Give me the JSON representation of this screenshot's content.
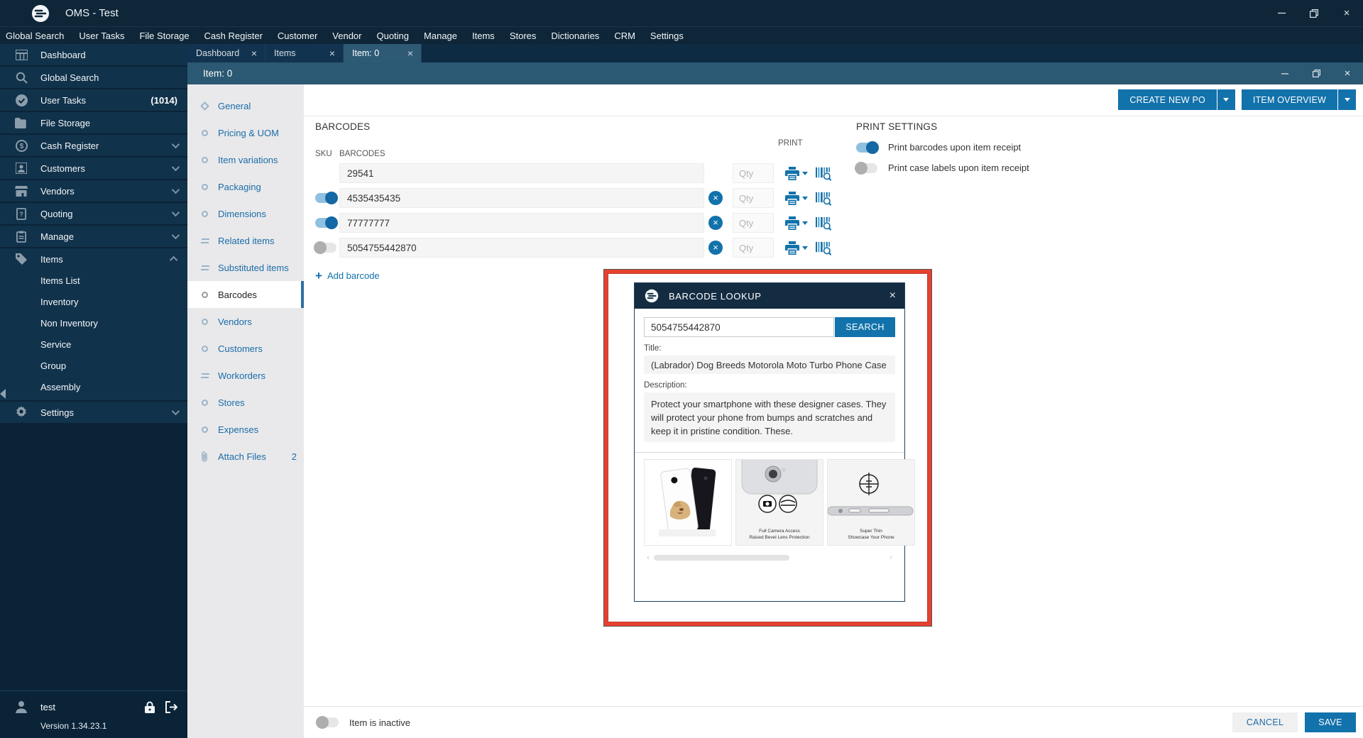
{
  "app": {
    "title": "OMS - Test"
  },
  "menu_bar": {
    "items": [
      "Global Search",
      "User Tasks",
      "File Storage",
      "Cash Register",
      "Customer",
      "Vendor",
      "Quoting",
      "Manage",
      "Items",
      "Stores",
      "Dictionaries",
      "CRM",
      "Settings"
    ]
  },
  "sidebar": {
    "items": [
      {
        "label": "Dashboard",
        "icon": "dashboard-icon"
      },
      {
        "label": "Global Search",
        "icon": "search-icon"
      },
      {
        "label": "User Tasks",
        "icon": "tasks-icon",
        "badge": "(1014)"
      },
      {
        "label": "File Storage",
        "icon": "folder-icon"
      },
      {
        "label": "Cash Register",
        "icon": "cash-icon",
        "chevron": "down"
      },
      {
        "label": "Customers",
        "icon": "person-icon",
        "chevron": "down"
      },
      {
        "label": "Vendors",
        "icon": "store-icon",
        "chevron": "down"
      },
      {
        "label": "Quoting",
        "icon": "quote-icon",
        "chevron": "down"
      },
      {
        "label": "Manage",
        "icon": "clipboard-icon",
        "chevron": "down"
      },
      {
        "label": "Items",
        "icon": "tag-icon",
        "chevron": "up",
        "expanded": true
      },
      {
        "label": "Settings",
        "icon": "gear-icon",
        "chevron": "down"
      }
    ],
    "items_sub": [
      "Items List",
      "Inventory",
      "Non Inventory",
      "Service",
      "Group",
      "Assembly"
    ],
    "user": {
      "name": "test",
      "version": "Version 1.34.23.1"
    }
  },
  "tabs": [
    {
      "label": "Dashboard",
      "active": false
    },
    {
      "label": "Items",
      "active": false
    },
    {
      "label": "Item: 0",
      "active": true
    }
  ],
  "item_window": {
    "title": "Item: 0",
    "nav": [
      {
        "label": "General",
        "icon": "diamond"
      },
      {
        "label": "Pricing & UOM",
        "icon": "circle"
      },
      {
        "label": "Item variations",
        "icon": "circle"
      },
      {
        "label": "Packaging",
        "icon": "circle"
      },
      {
        "label": "Dimensions",
        "icon": "circle"
      },
      {
        "label": "Related items",
        "icon": "equals"
      },
      {
        "label": "Substituted items",
        "icon": "equals"
      },
      {
        "label": "Barcodes",
        "icon": "circle",
        "selected": true
      },
      {
        "label": "Vendors",
        "icon": "circle"
      },
      {
        "label": "Customers",
        "icon": "circle"
      },
      {
        "label": "Workorders",
        "icon": "equals"
      },
      {
        "label": "Stores",
        "icon": "circle"
      },
      {
        "label": "Expenses",
        "icon": "circle"
      },
      {
        "label": "Attach Files",
        "icon": "paperclip",
        "badge": "2"
      }
    ],
    "actions": {
      "create_po": "CREATE NEW PO",
      "item_overview": "ITEM OVERVIEW"
    }
  },
  "barcodes": {
    "heading": "BARCODES",
    "col_sku": "SKU",
    "col_barcodes": "BARCODES",
    "col_print": "PRINT",
    "qty_placeholder": "Qty",
    "rows": [
      {
        "value": "29541",
        "toggle": null,
        "removable": false
      },
      {
        "value": "4535435435",
        "toggle": true,
        "removable": true
      },
      {
        "value": "77777777",
        "toggle": true,
        "removable": true
      },
      {
        "value": "5054755442870",
        "toggle": false,
        "removable": true
      }
    ],
    "add_label": "Add barcode"
  },
  "print_settings": {
    "heading": "PRINT SETTINGS",
    "options": [
      {
        "label": "Print barcodes upon item receipt",
        "on": true
      },
      {
        "label": "Print case labels upon item receipt",
        "on": false
      }
    ]
  },
  "modal": {
    "title": "BARCODE LOOKUP",
    "search_value": "5054755442870",
    "search_button": "SEARCH",
    "title_label": "Title:",
    "title_value": "(Labrador) Dog Breeds Motorola Moto Turbo Phone Case",
    "description_label": "Description:",
    "description_value": "Protect your smartphone with these designer cases. They will protect your phone from bumps and scratches and keep it in pristine condition. These.",
    "images": [
      {
        "name": "labrador-phone-case-photo"
      },
      {
        "name": "clear-case-camera-photo",
        "caption1": "Full Camera Access",
        "caption2": "Raised Bevel Lens Protection"
      },
      {
        "name": "thin-case-side-photo",
        "caption1": "Super Thin",
        "caption2": "Showcase Your Phone"
      }
    ]
  },
  "footer": {
    "inactive_label": "Item is inactive",
    "cancel": "CANCEL",
    "save": "SAVE"
  },
  "colors": {
    "accent": "#1272ab",
    "navy": "#0e2638",
    "inner_title": "#2b5872",
    "highlight_red": "#e8402f"
  }
}
